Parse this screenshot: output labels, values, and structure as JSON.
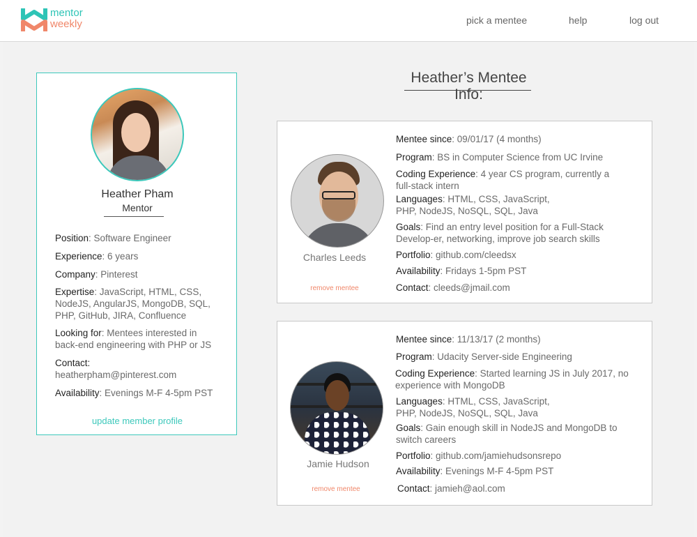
{
  "brand": {
    "line1": "mentor",
    "line2": "weekly",
    "colors": {
      "teal": "#2ec4b6",
      "coral": "#f0876a"
    }
  },
  "nav": {
    "pick": "pick a mentee",
    "help": "help",
    "logout": "log out"
  },
  "mentor": {
    "name": "Heather Pham",
    "role": "Mentor",
    "position_label": "Position",
    "position": ": Software Engineer",
    "experience_label": "Experience",
    "experience": ": 6 years",
    "company_label": "Company",
    "company": ": Pinterest",
    "expertise_label": "Expertise",
    "expertise": ": JavaScript, HTML, CSS, NodeJS, AngularJS, MongoDB, SQL, PHP, GitHub, JIRA, Confluence",
    "looking_label": "Looking for",
    "looking": ": Mentees interested in back-end engineering with PHP or JS",
    "contact_label": "Contact",
    "contact": "heatherpham@pinterest.com",
    "availability_label": "Availability",
    "availability": ": Evenings M-F 4-5pm PST",
    "update_link": "update member profile"
  },
  "heading": "Heather’s Mentee Info:",
  "mentees": [
    {
      "name": "Charles Leeds",
      "remove": "remove mentee",
      "since_label": "Mentee since",
      "since": ": 09/01/17  (4 months)",
      "program_label": "Program",
      "program": ": BS in Computer Science from UC Irvine",
      "coding_label": "Coding Experience",
      "coding": ": 4 year CS program, currently a full-stack intern",
      "languages_label": "Languages",
      "languages": ": HTML, CSS, JavaScript, PHP, NodeJS, NoSQL, SQL, Java",
      "goals_label": "Goals",
      "goals": ": Find an entry level position for a Full-Stack Develop-er, networking, improve job search skills",
      "portfolio_label": "Portfolio",
      "portfolio": ": github.com/cleedsx",
      "availability_label": "Availability",
      "availability": ": Fridays 1-5pm PST",
      "contact_label": "Contact",
      "contact": ": cleeds@jmail.com"
    },
    {
      "name": "Jamie Hudson",
      "remove": "remove mentee",
      "since_label": "Mentee since",
      "since": ": 11/13/17  (2 months)",
      "program_label": "Program",
      "program": ": Udacity Server-side Engineering",
      "coding_label": "Coding Experience",
      "coding": ": Started learning JS in July 2017, no experience with MongoDB",
      "languages_label": "Languages",
      "languages": ": HTML, CSS, JavaScript, PHP, NodeJS, NoSQL, SQL, Java",
      "goals_label": "Goals",
      "goals": ": Gain enough skill in NodeJS and MongoDB to switch careers",
      "portfolio_label": "Portfolio",
      "portfolio": ": github.com/jamiehudsonsrepo",
      "availability_label": "Availability",
      "availability": ": Evenings M-F 4-5pm PST",
      "contact_label": "Contact",
      "contact": ": jamieh@aol.com"
    }
  ]
}
